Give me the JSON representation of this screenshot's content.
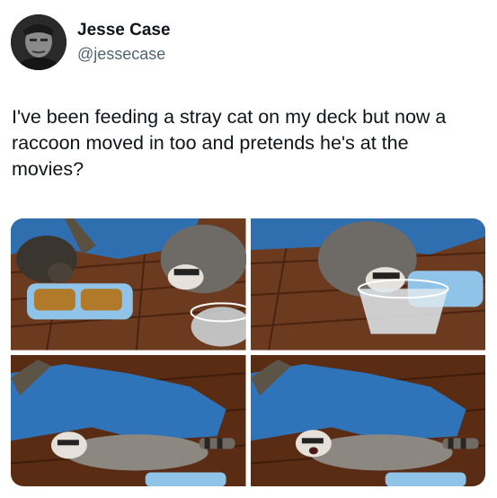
{
  "author": {
    "display_name": "Jesse Case",
    "handle": "@jessecase"
  },
  "tweet": {
    "text": "I've been feeding a stray cat on my deck but now a raccoon moved in too and pretends he's at the movies?"
  },
  "media": {
    "photo_count": 4
  },
  "icons": {
    "avatar": "user-avatar-photo"
  }
}
